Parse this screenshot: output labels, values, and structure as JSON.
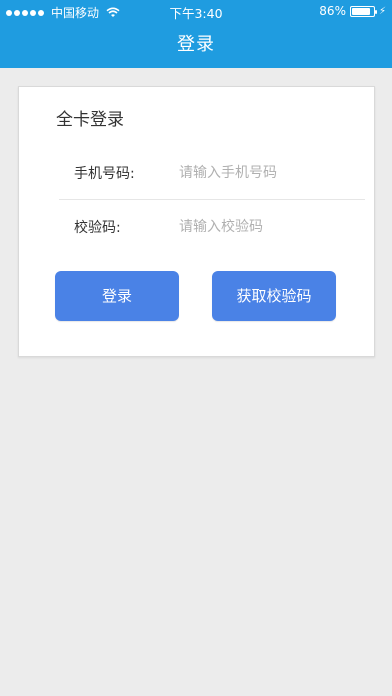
{
  "status_bar": {
    "carrier": "中国移动",
    "time": "下午3:40",
    "battery": "86%",
    "battery_level": 0.86,
    "signal_icon": "signal-dots-icon",
    "wifi_icon": "wifi-icon",
    "charging_icon": "bolt-icon"
  },
  "nav": {
    "title": "登录",
    "background": "#1f9ce0"
  },
  "card": {
    "title": "全卡登录",
    "phone": {
      "label": "手机号码:",
      "value": "",
      "placeholder": "请输入手机号码"
    },
    "code": {
      "label": "校验码:",
      "value": "",
      "placeholder": "请输入校验码"
    },
    "login_button": "登录",
    "get_code_button": "获取校验码",
    "button_color": "#4a82e6"
  }
}
